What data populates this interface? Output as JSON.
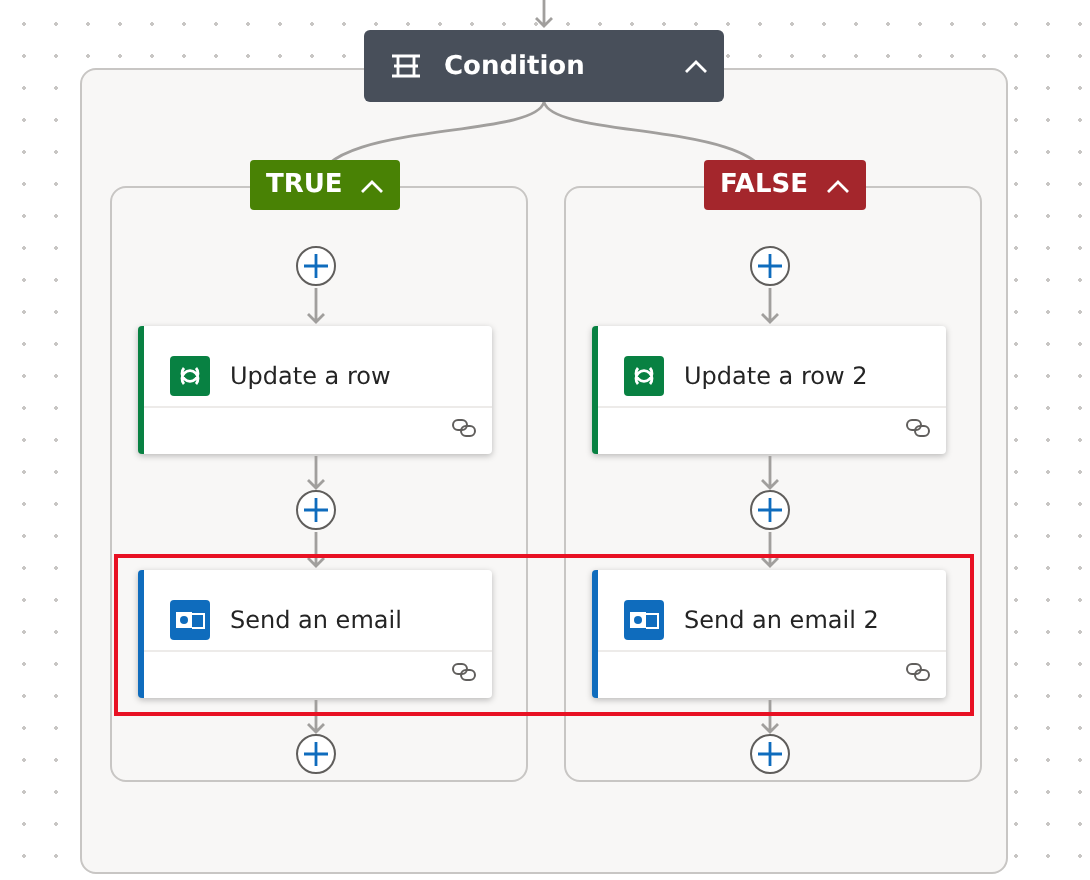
{
  "condition": {
    "title": "Condition",
    "expanded": true
  },
  "branches": [
    {
      "label": "TRUE",
      "kind": "true",
      "expanded": true,
      "actions": [
        {
          "title": "Update a row",
          "kind": "dataverse",
          "highlighted": false
        },
        {
          "title": "Send an email",
          "kind": "outlook",
          "highlighted": true
        }
      ]
    },
    {
      "label": "FALSE",
      "kind": "false",
      "expanded": true,
      "actions": [
        {
          "title": "Update a row 2",
          "kind": "dataverse",
          "highlighted": false
        },
        {
          "title": "Send an email 2",
          "kind": "outlook",
          "highlighted": true
        }
      ]
    }
  ]
}
